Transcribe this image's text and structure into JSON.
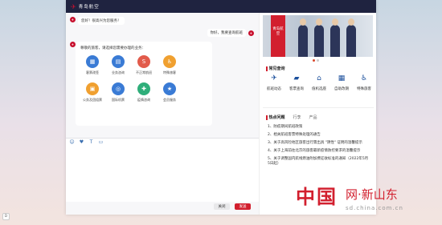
{
  "header": {
    "logo_mark": "✈",
    "logo_text": "青岛航空"
  },
  "chat": {
    "greeting": "您好！很高兴为您服务！",
    "user_message": "你好，我要查询航班",
    "bot_avatar": "bot-avatar",
    "service_prompt": "尊敬的旅客，请选择您需要办理的业务：",
    "services": [
      {
        "label": "客票改签",
        "icon": "ticket-icon",
        "glyph": "▦",
        "color": "#3a7bd5"
      },
      {
        "label": "业务咨询",
        "icon": "consult-icon",
        "glyph": "▤",
        "color": "#3a7bd5"
      },
      {
        "label": "不正常航班",
        "icon": "flight-irregular-icon",
        "glyph": "S",
        "color": "#e25b4b"
      },
      {
        "label": "特殊旅客",
        "icon": "special-passenger-icon",
        "glyph": "♿",
        "color": "#f0a030"
      },
      {
        "label": "",
        "icon": "",
        "glyph": "",
        "color": ""
      },
      {
        "label": "公务及团组票",
        "icon": "group-ticket-icon",
        "glyph": "▣",
        "color": "#f0a030"
      },
      {
        "label": "国际机票",
        "icon": "international-icon",
        "glyph": "◎",
        "color": "#3a7bd5"
      },
      {
        "label": "疫情咨询",
        "icon": "epidemic-icon",
        "glyph": "✚",
        "color": "#2fae7a"
      },
      {
        "label": "会员服务",
        "icon": "member-icon",
        "glyph": "★",
        "color": "#3a7bd5"
      }
    ]
  },
  "toolbar": {
    "emoji": "☺",
    "heart": "♥",
    "text": "T",
    "image": "▭",
    "close_label": "关闭",
    "send_label": "发送"
  },
  "right_panel": {
    "banner_text": "青岛航空",
    "common_title": "常见查询",
    "common_items": [
      {
        "label": "航班动态",
        "icon": "flight-status-icon",
        "glyph": "✈"
      },
      {
        "label": "客票查询",
        "icon": "ticket-query-icon",
        "glyph": "▰"
      },
      {
        "label": "值机选座",
        "icon": "seat-icon",
        "glyph": "⌂"
      },
      {
        "label": "自助改期",
        "icon": "reschedule-icon",
        "glyph": "▦"
      },
      {
        "label": "特殊旅客",
        "icon": "special-passenger-icon",
        "glyph": "♿"
      }
    ],
    "hot_title": "热点问题",
    "hot_tabs": [
      "行李",
      "产品"
    ],
    "hot_list": [
      "1、防疫期间航班政策",
      "2、相关航班客票特殊处理的通告",
      "3、关于高风险地区旅客出行需出具 \"阴性\" 证明的温馨提示",
      "4、关于上海前往北京的旅客最新疫情防控要求的温馨提示",
      "5、关于调整国内航线燃油附加费征收标准的通知（2022年5月5日起）"
    ]
  },
  "help_label": "D",
  "watermark": {
    "big": "中国",
    "side": "网·新山东",
    "url": "sd.china.com.cn"
  }
}
